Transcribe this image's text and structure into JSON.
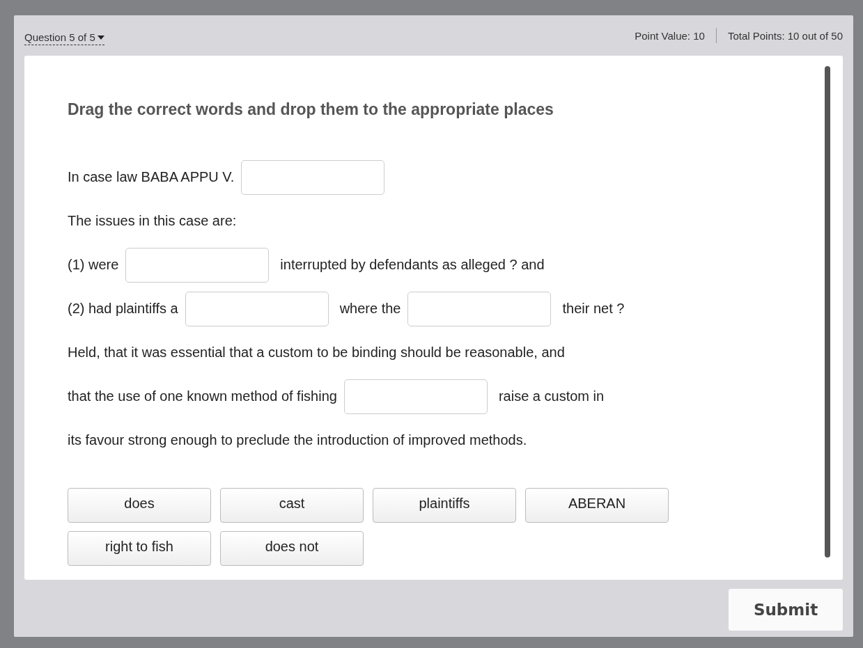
{
  "header": {
    "question_menu": "Question 5 of 5",
    "point_value": "Point Value: 10",
    "total_points": "Total Points: 10 out of 50"
  },
  "instruction": "Drag the correct words and drop them to the appropriate places",
  "lines": [
    [
      {
        "kind": "text",
        "text": "In case law BABA APPU V."
      },
      {
        "kind": "blank"
      }
    ],
    [
      {
        "kind": "text",
        "text": "The issues in this case are:"
      }
    ],
    [
      {
        "kind": "text",
        "text": "(1) were"
      },
      {
        "kind": "blank"
      },
      {
        "kind": "text",
        "text": "interrupted by defendants as alleged ? and"
      }
    ],
    [
      {
        "kind": "text",
        "text": "(2) had plaintiffs a"
      },
      {
        "kind": "blank"
      },
      {
        "kind": "text",
        "text": "where the"
      },
      {
        "kind": "blank"
      },
      {
        "kind": "text",
        "text": "their net ?"
      }
    ],
    [
      {
        "kind": "text",
        "text": "Held, that it was essential that a custom to be binding should be reasonable, and"
      }
    ],
    [
      {
        "kind": "text",
        "text": "that the use of one known method of fishing"
      },
      {
        "kind": "blank"
      },
      {
        "kind": "text",
        "text": "raise a custom in"
      }
    ],
    [
      {
        "kind": "text",
        "text": "its favour strong enough to preclude the introduction of improved methods."
      }
    ]
  ],
  "word_bank": [
    "does",
    "cast",
    "plaintiffs",
    "ABERAN",
    "right to fish",
    "does not"
  ],
  "submit_button": "Submit"
}
